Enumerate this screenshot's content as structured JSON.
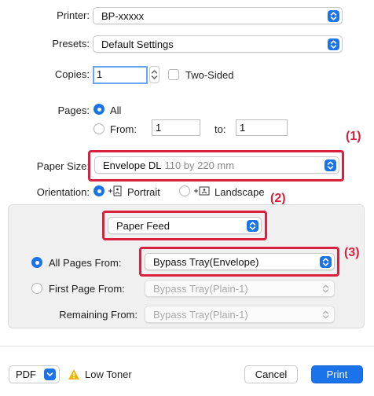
{
  "printer": {
    "label": "Printer:",
    "value": "BP-xxxxx"
  },
  "presets": {
    "label": "Presets:",
    "value": "Default Settings"
  },
  "copies": {
    "label": "Copies:",
    "value": "1",
    "two_sided_label": "Two-Sided"
  },
  "pages": {
    "label": "Pages:",
    "all_label": "All",
    "from_label": "From:",
    "from_value": "1",
    "to_label": "to:",
    "to_value": "1"
  },
  "paper_size": {
    "label": "Paper Size:",
    "value": "Envelope DL",
    "detail": "110 by 220 mm"
  },
  "orientation": {
    "label": "Orientation:",
    "portrait_label": "Portrait",
    "landscape_label": "Landscape"
  },
  "section_menu": {
    "value": "Paper Feed"
  },
  "paper_feed": {
    "all_pages_label": "All Pages From:",
    "all_pages_value": "Bypass Tray(Envelope)",
    "first_page_label": "First Page From:",
    "first_page_value": "Bypass Tray(Plain-1)",
    "remaining_label": "Remaining From:",
    "remaining_value": "Bypass Tray(Plain-1)"
  },
  "callouts": {
    "c1": "(1)",
    "c2": "(2)",
    "c3": "(3)"
  },
  "footer": {
    "pdf_label": "PDF",
    "warning_text": "Low Toner",
    "cancel_label": "Cancel",
    "print_label": "Print"
  },
  "colors": {
    "accent": "#1a73e8",
    "callout": "#d8213f",
    "warning": "#f5b400"
  }
}
